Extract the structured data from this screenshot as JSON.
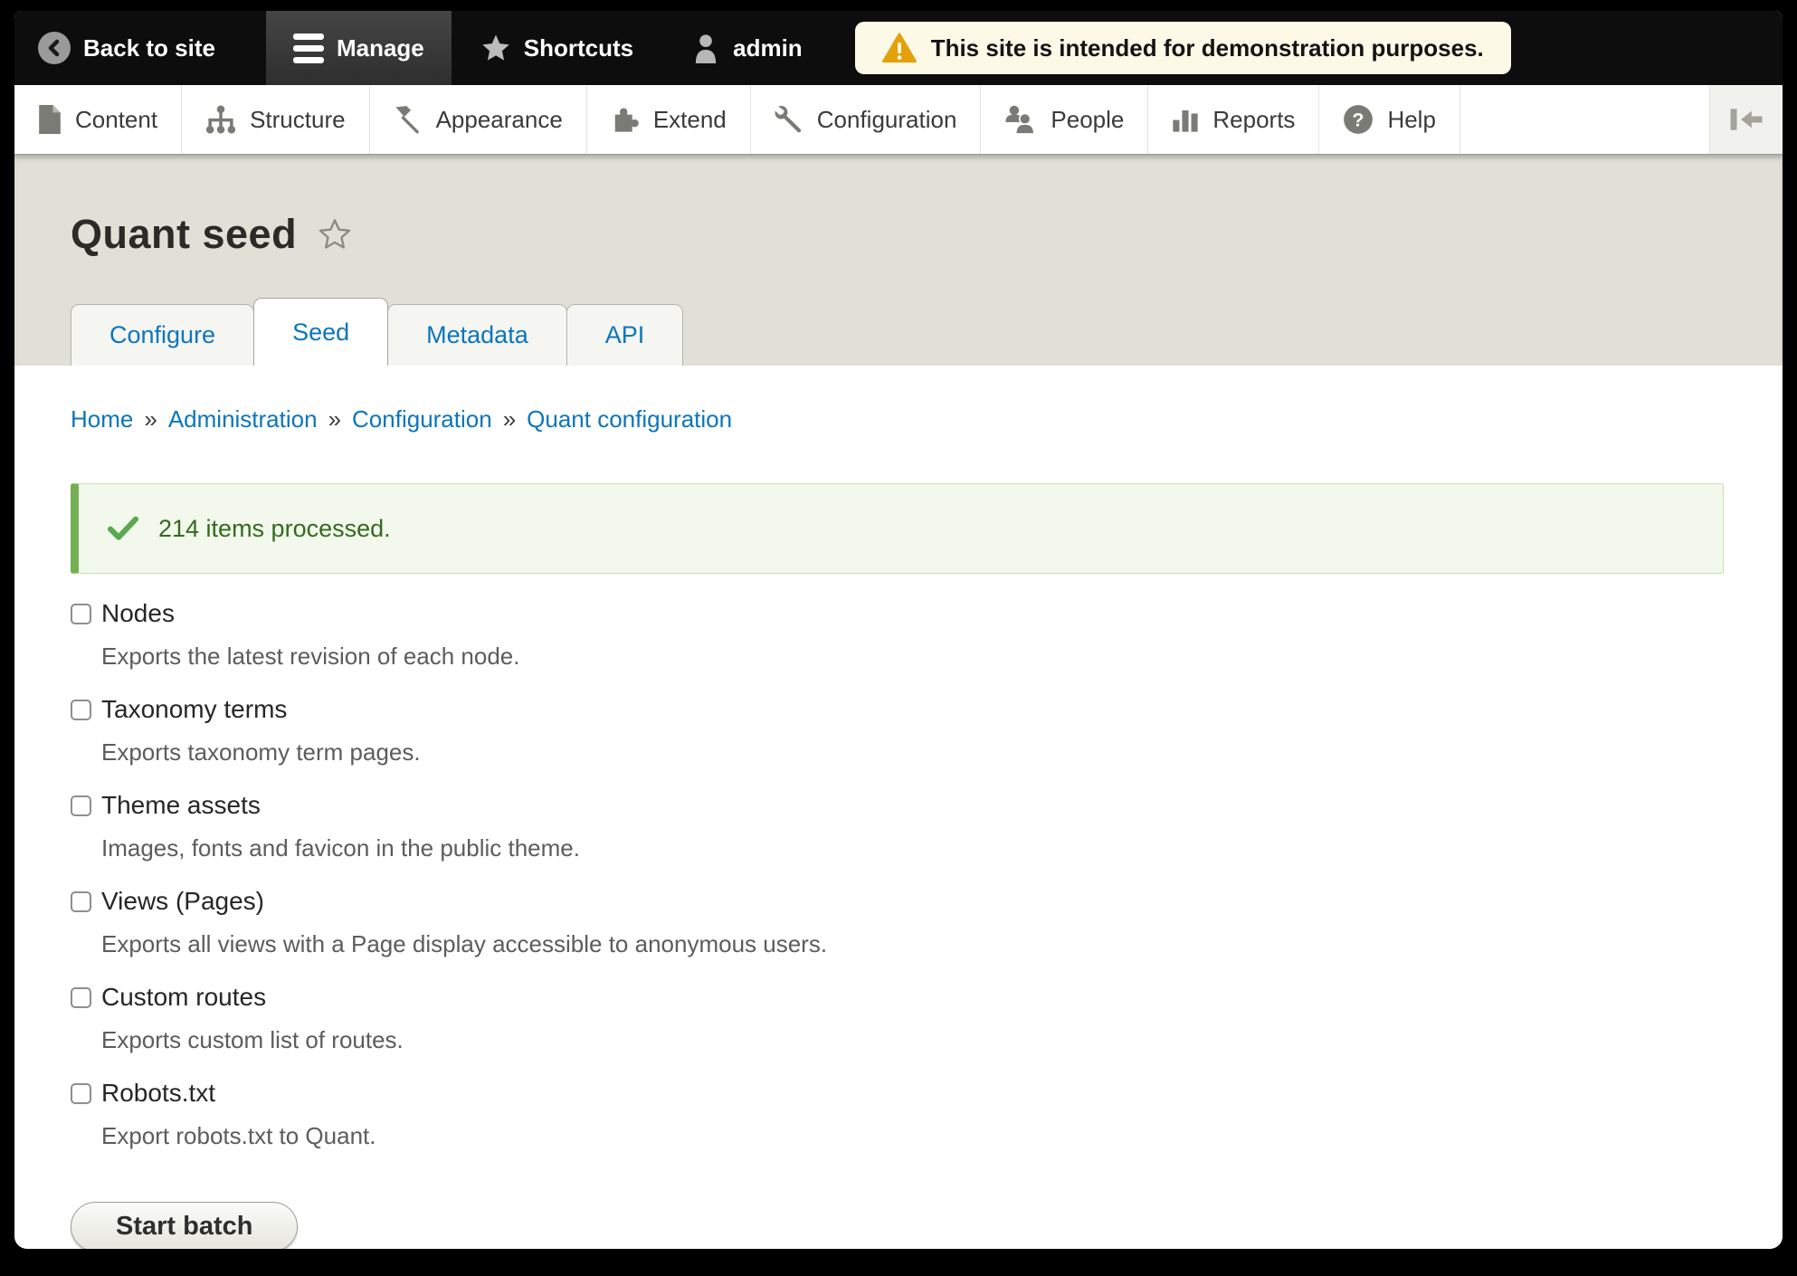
{
  "admin_bar": {
    "back_to_site": "Back to site",
    "manage": "Manage",
    "shortcuts": "Shortcuts",
    "user": "admin",
    "warning": "This site is intended for demonstration purposes."
  },
  "toolbar": {
    "items": [
      {
        "label": "Content",
        "icon": "content-icon"
      },
      {
        "label": "Structure",
        "icon": "structure-icon"
      },
      {
        "label": "Appearance",
        "icon": "appearance-icon"
      },
      {
        "label": "Extend",
        "icon": "extend-icon"
      },
      {
        "label": "Configuration",
        "icon": "configuration-icon"
      },
      {
        "label": "People",
        "icon": "people-icon"
      },
      {
        "label": "Reports",
        "icon": "reports-icon"
      },
      {
        "label": "Help",
        "icon": "help-icon"
      }
    ]
  },
  "header": {
    "title": "Quant seed"
  },
  "tabs": [
    {
      "label": "Configure",
      "active": false
    },
    {
      "label": "Seed",
      "active": true
    },
    {
      "label": "Metadata",
      "active": false
    },
    {
      "label": "API",
      "active": false
    }
  ],
  "breadcrumb": {
    "separator": "»",
    "items": [
      "Home",
      "Administration",
      "Configuration",
      "Quant configuration"
    ]
  },
  "message": {
    "text": "214 items processed."
  },
  "seed_items": [
    {
      "label": "Nodes",
      "description": "Exports the latest revision of each node.",
      "checked": false
    },
    {
      "label": "Taxonomy terms",
      "description": "Exports taxonomy term pages.",
      "checked": false
    },
    {
      "label": "Theme assets",
      "description": "Images, fonts and favicon in the public theme.",
      "checked": false
    },
    {
      "label": "Views (Pages)",
      "description": "Exports all views with a Page display accessible to anonymous users.",
      "checked": false
    },
    {
      "label": "Custom routes",
      "description": "Exports custom list of routes.",
      "checked": false
    },
    {
      "label": "Robots.txt",
      "description": "Export robots.txt to Quant.",
      "checked": false
    }
  ],
  "actions": {
    "start_batch": "Start batch"
  },
  "colors": {
    "accent_blue": "#0b76bc",
    "success_green_border": "#74b052",
    "success_green_bg": "#f2f9ec",
    "success_green_text": "#35691f",
    "warning_orange": "#e3a20c",
    "warning_bg": "#fdf9e7",
    "header_beige": "#e1e0d7",
    "admin_bar_black": "#0d0d0d"
  }
}
